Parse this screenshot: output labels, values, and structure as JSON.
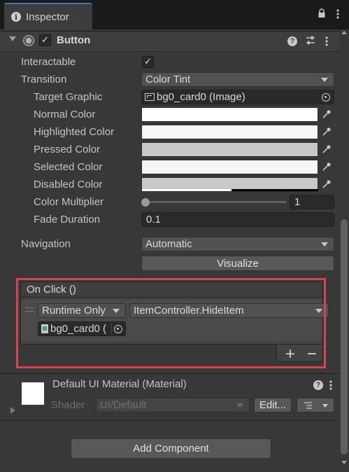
{
  "tab": {
    "title": "Inspector",
    "info_icon": "i"
  },
  "component": {
    "title": "Button",
    "enabled_check": "✓"
  },
  "properties": {
    "interactable": {
      "label": "Interactable",
      "checked": true,
      "check": "✓"
    },
    "transition": {
      "label": "Transition",
      "value": "Color Tint"
    },
    "target_graphic": {
      "label": "Target Graphic",
      "value": "bg0_card0 (Image)"
    },
    "normal_color": {
      "label": "Normal Color",
      "color": "#ffffff"
    },
    "highlighted_color": {
      "label": "Highlighted Color",
      "color": "#f5f5f5"
    },
    "pressed_color": {
      "label": "Pressed Color",
      "color": "#c8c8c8"
    },
    "selected_color": {
      "label": "Selected Color",
      "color": "#f5f5f5"
    },
    "disabled_color": {
      "label": "Disabled Color",
      "color": "#c8c8c8"
    },
    "color_multiplier": {
      "label": "Color Multiplier",
      "value": "1",
      "slider_fraction": 0.0
    },
    "fade_duration": {
      "label": "Fade Duration",
      "value": "0.1"
    },
    "navigation": {
      "label": "Navigation",
      "value": "Automatic"
    },
    "visualize": {
      "label": "Visualize"
    }
  },
  "on_click": {
    "header": "On Click ()",
    "runtime": "Runtime Only",
    "function": "ItemController.HideItem",
    "target": "bg0_card0 (",
    "add": "+",
    "remove": "−"
  },
  "material": {
    "title": "Default UI Material (Material)",
    "shader_label": "Shader",
    "shader_value": "UI/Default",
    "edit_label": "Edit...",
    "help": "?"
  },
  "add_component": {
    "label": "Add Component"
  },
  "colors": {
    "highlight_border": "#d9424e",
    "tab_accent": "#3a79bb"
  }
}
